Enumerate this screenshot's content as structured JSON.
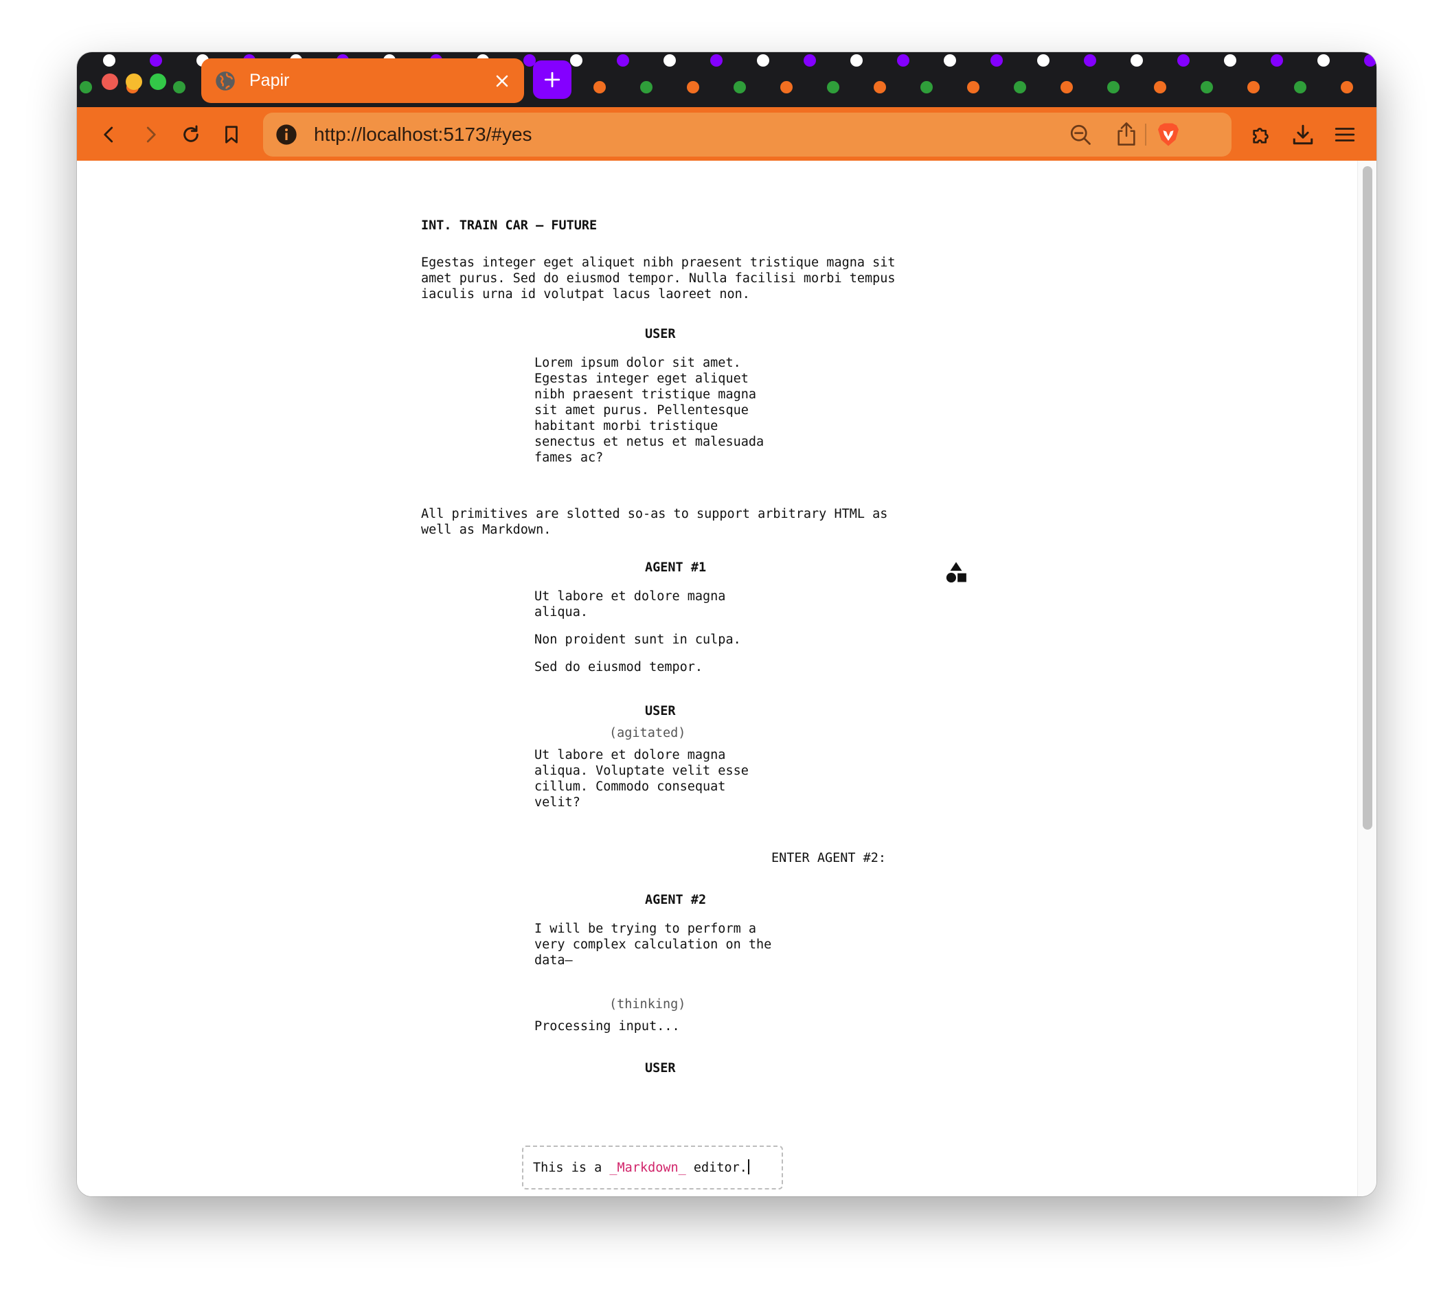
{
  "window": {
    "tab_title": "Papir",
    "url": "http://localhost:5173/#yes"
  },
  "colors": {
    "accent": "#f26f21",
    "newtab": "#8400ff",
    "markdown": "#d1246a"
  },
  "icons": {
    "tab": "globe-icon",
    "tab_close": "close-icon",
    "new_tab": "plus-icon",
    "back": "back-icon",
    "forward": "forward-icon",
    "reload": "reload-icon",
    "bookmark": "bookmark-icon",
    "site_info": "info-icon",
    "zoom": "zoom-out-icon",
    "share": "share-icon",
    "brave_shields": "brave-lion-icon",
    "extensions": "puzzle-icon",
    "downloads": "download-icon",
    "menu": "hamburger-menu-icon",
    "primitives": "shapes-icon"
  },
  "screenplay": {
    "scene_heading": "INT. TRAIN CAR — FUTURE",
    "action_1": "Egestas integer eget aliquet nibh praesent tristique magna sit\namet purus. Sed do eiusmod tempor. Nulla facilisi morbi tempus\niaculis urna id volutpat lacus laoreet non.",
    "character_1": "USER",
    "dialogue_1": "Lorem ipsum dolor sit amet.\nEgestas integer eget aliquet\nnibh praesent tristique magna\nsit amet purus. Pellentesque\nhabitant morbi tristique\nsenectus et netus et malesuada\nfames ac?",
    "action_2": "All primitives are slotted so-as to support arbitrary HTML as\nwell as Markdown.",
    "character_2": "AGENT #1",
    "dialogue_2a": "Ut labore et dolore magna\naliqua.",
    "dialogue_2b": "Non proident sunt in culpa.",
    "dialogue_2c": "Sed do eiusmod tempor.",
    "character_3": "USER",
    "parenthetical_3": "(agitated)",
    "dialogue_3": "Ut labore et dolore magna\naliqua. Voluptate velit esse\ncillum. Commodo consequat\nvelit?",
    "transition": "ENTER AGENT #2:",
    "character_4": "AGENT #2",
    "dialogue_4": "I will be trying to perform a\nvery complex calculation on the\ndata—",
    "parenthetical_4": "(thinking)",
    "dialogue_4b": "Processing input...",
    "character_5": "USER",
    "editor": {
      "before": "This is a ",
      "markdown": "_Markdown_",
      "after": " editor."
    }
  }
}
